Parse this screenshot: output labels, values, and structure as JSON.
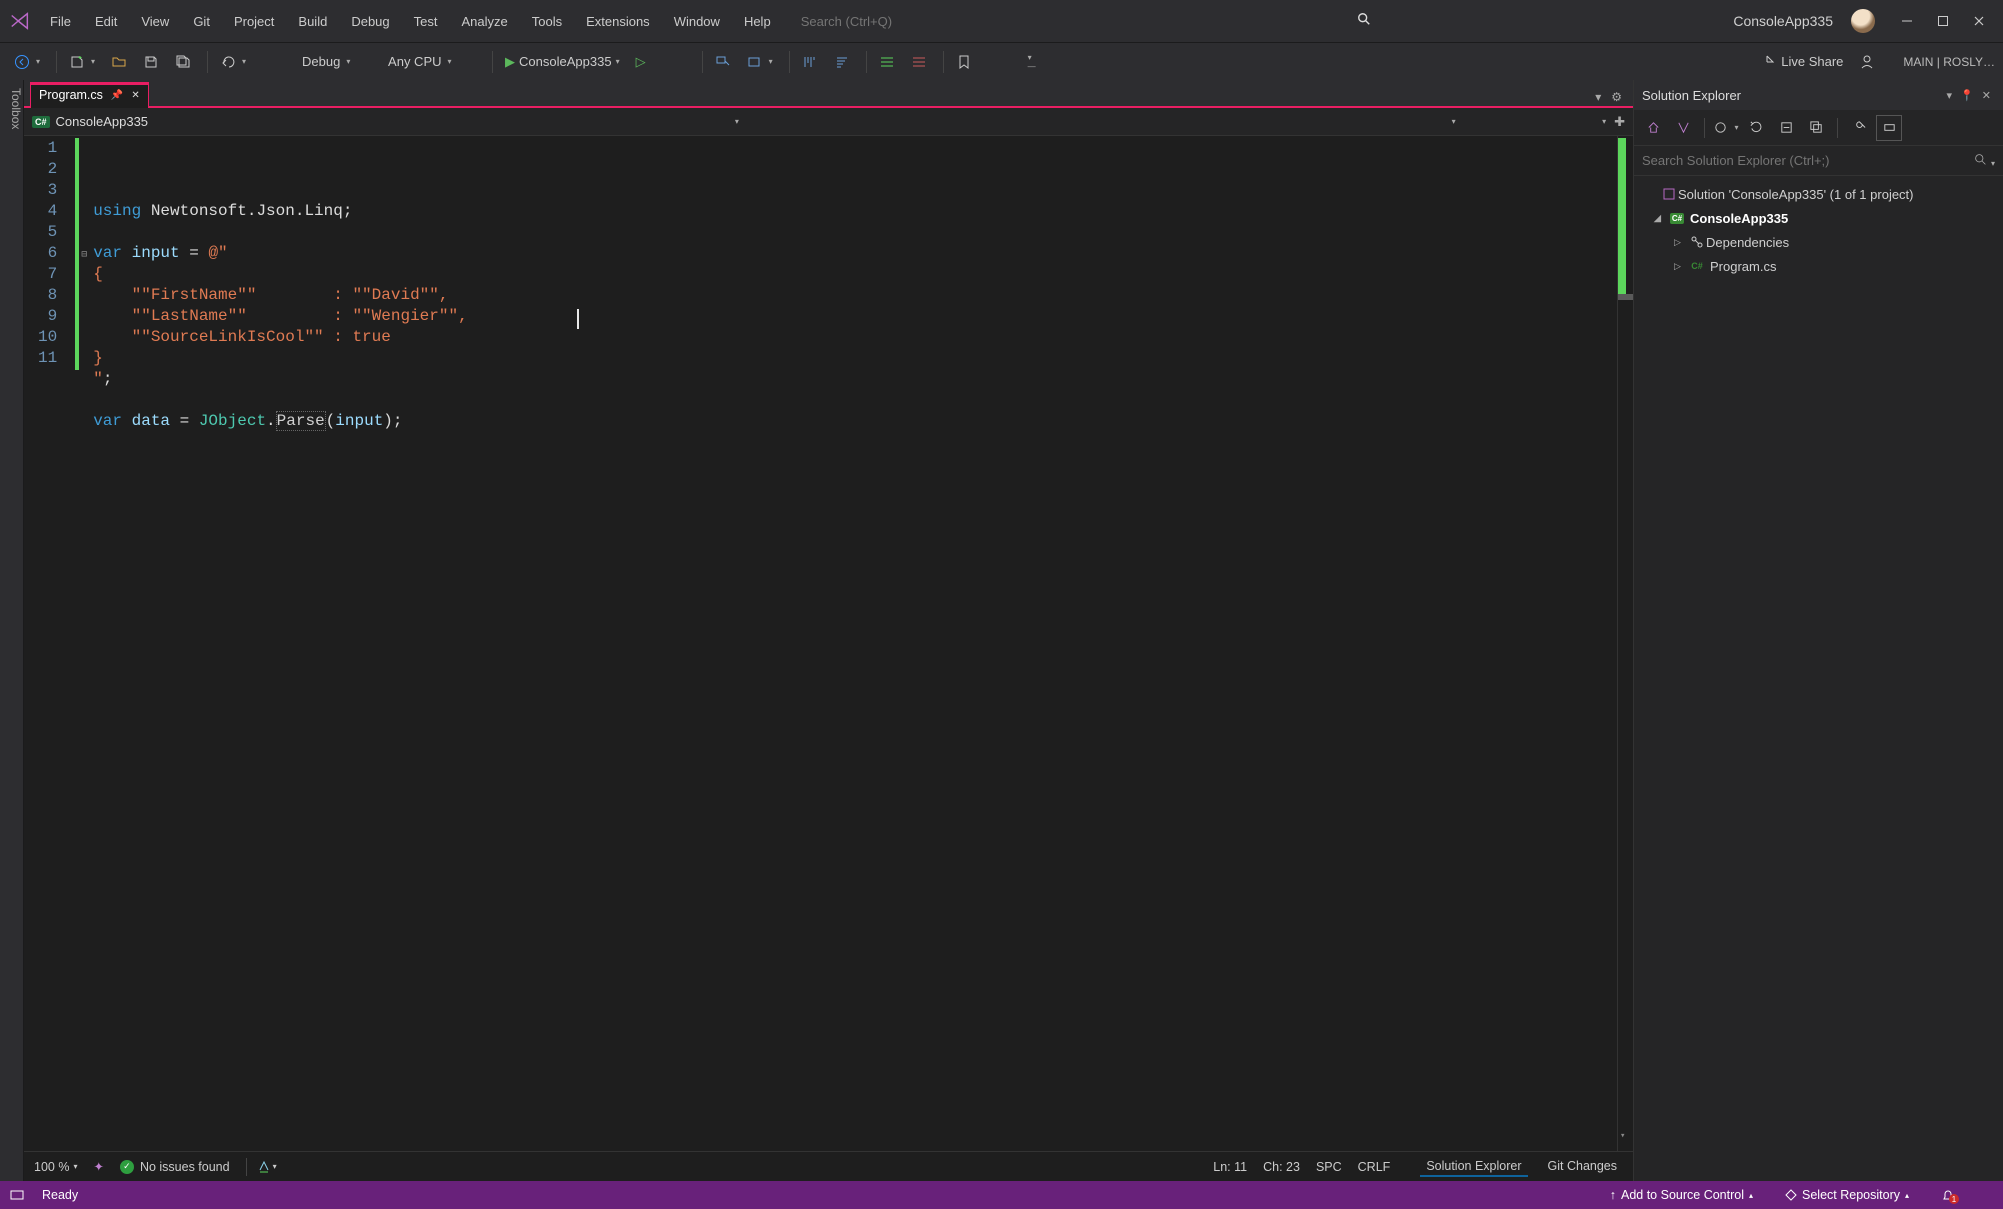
{
  "menus": [
    "File",
    "Edit",
    "View",
    "Git",
    "Project",
    "Build",
    "Debug",
    "Test",
    "Analyze",
    "Tools",
    "Extensions",
    "Window",
    "Help"
  ],
  "search_placeholder": "Search (Ctrl+Q)",
  "app_title": "ConsoleApp335",
  "toolbar": {
    "config": "Debug",
    "platform": "Any CPU",
    "run_target": "ConsoleApp335",
    "live_share": "Live Share",
    "branch": "MAIN | ROSLY…"
  },
  "toolbox_label": "Toolbox",
  "tab": {
    "filename": "Program.cs"
  },
  "nav": {
    "project": "ConsoleApp335"
  },
  "code": {
    "lines": [
      {
        "n": "1",
        "seg": [
          {
            "t": "using ",
            "c": "tok-kw"
          },
          {
            "t": "Newtonsoft",
            "c": "tok-white"
          },
          {
            "t": ".",
            "c": "tok-white"
          },
          {
            "t": "Json",
            "c": "tok-white"
          },
          {
            "t": ".",
            "c": "tok-white"
          },
          {
            "t": "Linq",
            "c": "tok-white"
          },
          {
            "t": ";",
            "c": "tok-white"
          }
        ]
      },
      {
        "n": "2",
        "seg": []
      },
      {
        "n": "3",
        "seg": [
          {
            "t": "var ",
            "c": "tok-kw"
          },
          {
            "t": "input",
            "c": "tok-var"
          },
          {
            "t": " = ",
            "c": "tok-white"
          },
          {
            "t": "@\"",
            "c": "tok-str"
          }
        ],
        "collapsible": true
      },
      {
        "n": "4",
        "seg": [
          {
            "t": "{",
            "c": "tok-str"
          }
        ]
      },
      {
        "n": "5",
        "seg": [
          {
            "t": "    \"\"FirstName\"\"",
            "c": "tok-str"
          },
          {
            "t": "        : ",
            "c": "tok-str"
          },
          {
            "t": "\"\"David\"\"",
            "c": "tok-str"
          },
          {
            "t": ",",
            "c": "tok-str"
          }
        ]
      },
      {
        "n": "6",
        "seg": [
          {
            "t": "    \"\"LastName\"\"",
            "c": "tok-str"
          },
          {
            "t": "         : ",
            "c": "tok-str"
          },
          {
            "t": "\"\"Wengier\"\"",
            "c": "tok-str"
          },
          {
            "t": ",",
            "c": "tok-str"
          }
        ]
      },
      {
        "n": "7",
        "seg": [
          {
            "t": "    \"\"SourceLinkIsCool\"\"",
            "c": "tok-str"
          },
          {
            "t": " : ",
            "c": "tok-str"
          },
          {
            "t": "true",
            "c": "tok-str"
          }
        ]
      },
      {
        "n": "8",
        "seg": [
          {
            "t": "}",
            "c": "tok-str"
          }
        ]
      },
      {
        "n": "9",
        "seg": [
          {
            "t": "\"",
            "c": "tok-str"
          },
          {
            "t": ";",
            "c": "tok-white"
          }
        ]
      },
      {
        "n": "10",
        "seg": []
      },
      {
        "n": "11",
        "seg": [
          {
            "t": "var ",
            "c": "tok-kw"
          },
          {
            "t": "data",
            "c": "tok-var"
          },
          {
            "t": " = ",
            "c": "tok-white"
          },
          {
            "t": "JObject",
            "c": "tok-type"
          },
          {
            "t": ".",
            "c": "tok-white"
          },
          {
            "t": "Parse",
            "c": "tok-method"
          },
          {
            "t": "(",
            "c": "tok-white"
          },
          {
            "t": "input",
            "c": "tok-var"
          },
          {
            "t": ")",
            "c": "tok-white"
          },
          {
            "t": ";",
            "c": "tok-white"
          }
        ]
      }
    ]
  },
  "editor_status": {
    "zoom": "100 %",
    "issues": "No issues found",
    "ln": "Ln: 11",
    "ch": "Ch: 23",
    "spc": "SPC",
    "crlf": "CRLF",
    "tab1": "Solution Explorer",
    "tab2": "Git Changes"
  },
  "solution": {
    "title": "Solution Explorer",
    "search_placeholder": "Search Solution Explorer (Ctrl+;)",
    "root": "Solution 'ConsoleApp335' (1 of 1 project)",
    "project": "ConsoleApp335",
    "deps": "Dependencies",
    "file": "Program.cs"
  },
  "status": {
    "ready": "Ready",
    "add_source": "Add to Source Control",
    "select_repo": "Select Repository"
  }
}
